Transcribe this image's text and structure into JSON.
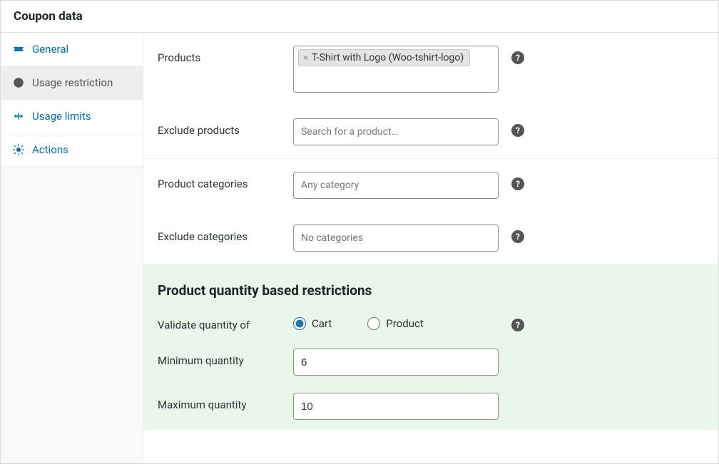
{
  "panel": {
    "title": "Coupon data"
  },
  "sidebar": {
    "items": [
      {
        "label": "General"
      },
      {
        "label": "Usage restriction"
      },
      {
        "label": "Usage limits"
      },
      {
        "label": "Actions"
      }
    ]
  },
  "fields": {
    "products": {
      "label": "Products",
      "tokens": [
        "T-Shirt with Logo (Woo-tshirt-logo)"
      ]
    },
    "excludeProducts": {
      "label": "Exclude products",
      "placeholder": "Search for a product…"
    },
    "productCategories": {
      "label": "Product categories",
      "placeholder": "Any category"
    },
    "excludeCategories": {
      "label": "Exclude categories",
      "placeholder": "No categories"
    }
  },
  "qtySection": {
    "title": "Product quantity based restrictions",
    "validateLabel": "Validate quantity of",
    "radio": {
      "cart": "Cart",
      "product": "Product",
      "selected": "cart"
    },
    "minLabel": "Minimum quantity",
    "minValue": "6",
    "maxLabel": "Maximum quantity",
    "maxValue": "10"
  }
}
